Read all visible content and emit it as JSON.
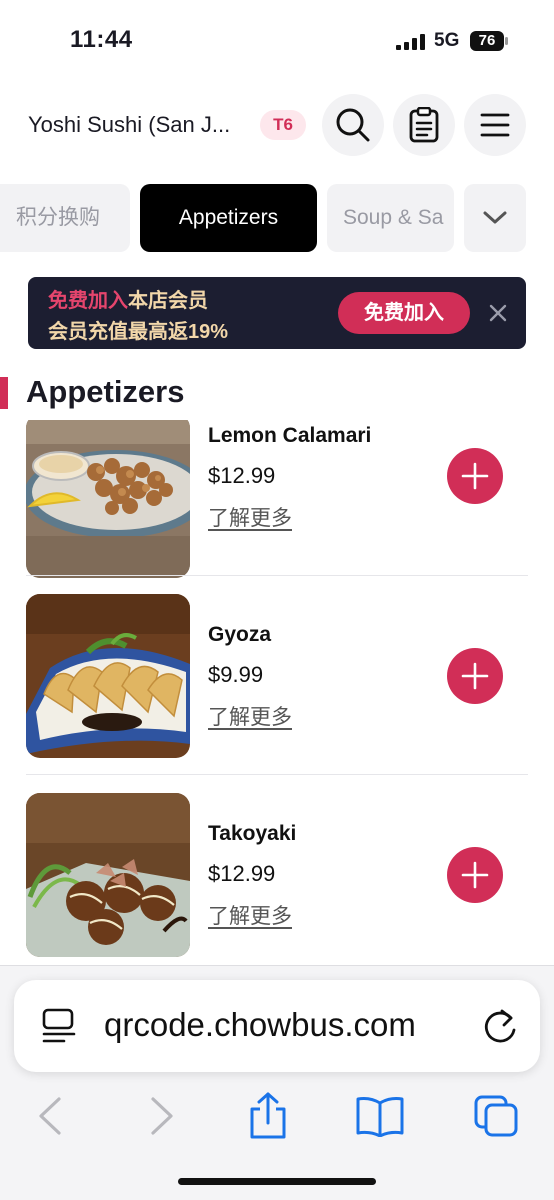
{
  "status_bar": {
    "time": "11:44",
    "network": "5G",
    "battery": "76"
  },
  "header": {
    "store_name": "Yoshi Sushi (San J...",
    "table_badge": "T6",
    "icons": [
      "search-icon",
      "order-list-icon",
      "menu-icon"
    ]
  },
  "categories": {
    "items": [
      {
        "label": "积分换购",
        "active": false
      },
      {
        "label": "Appetizers",
        "active": true
      },
      {
        "label": "Soup & Sa",
        "active": false
      }
    ],
    "more_icon": "chevron-down-icon"
  },
  "member_banner": {
    "line1_highlight": "免费加入",
    "line1_rest": "本店会员",
    "line2": "会员充值最高返19%",
    "join_label": "免费加入",
    "close_icon": "close-icon"
  },
  "section": {
    "title": "Appetizers"
  },
  "menu_items": [
    {
      "name": "Lemon Calamari",
      "price": "$12.99",
      "more": "了解更多",
      "image": "fried-calamari-photo"
    },
    {
      "name": "Gyoza",
      "price": "$9.99",
      "more": "了解更多",
      "image": "gyoza-photo"
    },
    {
      "name": "Takoyaki",
      "price": "$12.99",
      "more": "了解更多",
      "image": "takoyaki-photo"
    }
  ],
  "browser": {
    "url": "qrcode.chowbus.com",
    "toolbar": [
      "back-icon",
      "forward-icon",
      "share-icon",
      "bookmarks-icon",
      "tabs-icon"
    ]
  },
  "colors": {
    "accent": "#d12e57",
    "banner_bg": "#1c1e31",
    "banner_text": "#f2d7aa",
    "active_tab": "#000000"
  }
}
